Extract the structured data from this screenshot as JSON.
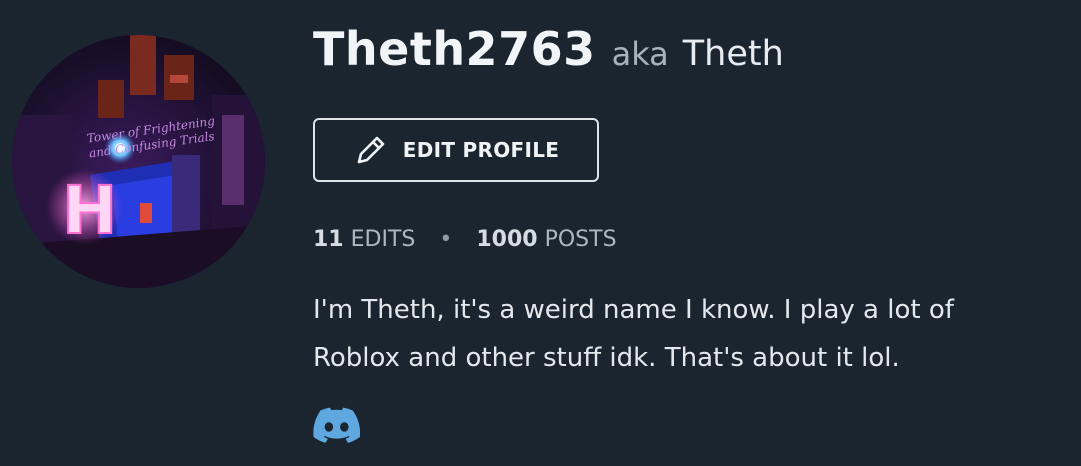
{
  "profile": {
    "username": "Theth2763",
    "aka_label": "aka",
    "nickname": "Theth",
    "edit_button_label": "EDIT PROFILE",
    "edit_icon": "pencil-icon",
    "avatar_text": {
      "line1": "Tower of Frightening",
      "line2": "and Confusing Trials",
      "letter": "H"
    },
    "stats": {
      "edits_count": "11",
      "edits_label": "EDITS",
      "separator": "•",
      "posts_count": "1000",
      "posts_label": "POSTS"
    },
    "bio_line1": "I'm Theth, it's a weird name I know. I play a lot of",
    "bio_line2": "Roblox and other stuff idk. That's about it lol.",
    "social_icon": "discord-icon"
  },
  "colors": {
    "background": "#1b2530",
    "discord": "#5fa8df",
    "neon_pink": "#ff7ad9"
  }
}
